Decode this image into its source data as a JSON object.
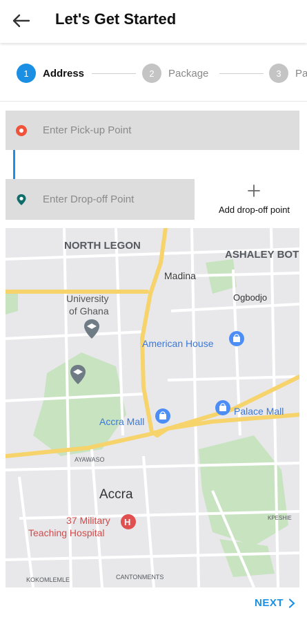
{
  "header": {
    "title": "Let's Get Started"
  },
  "stepper": {
    "steps": [
      {
        "number": "1",
        "label": "Address",
        "state": "active"
      },
      {
        "number": "2",
        "label": "Package",
        "state": "inactive"
      },
      {
        "number": "3",
        "label": "Pa",
        "state": "inactive"
      }
    ]
  },
  "form": {
    "pickup_placeholder": "Enter Pick-up Point",
    "dropoff_placeholder": "Enter Drop-off Point",
    "add_dropoff_label": "Add drop-off point"
  },
  "map": {
    "areas": [
      "NORTH LEGON",
      "ASHALEY BOT",
      "AYAWASO",
      "KOKOMLEMLE",
      "CANTONMENTS",
      "KPESHIE"
    ],
    "places": [
      "Madina",
      "Ogbodjo",
      "University",
      "of Ghana",
      "Accra"
    ],
    "pois": [
      "American House",
      "Accra Mall",
      "Palace Mall"
    ],
    "hospital": [
      "37 Military",
      "Teaching Hospital"
    ]
  },
  "footer": {
    "next_label": "NEXT"
  },
  "colors": {
    "accent": "#1a8fe3",
    "pickup_marker": "#f0533a",
    "dropoff_marker": "#0f6e6a",
    "field_bg": "#dddddd",
    "step_inactive": "#c4c4c4"
  }
}
